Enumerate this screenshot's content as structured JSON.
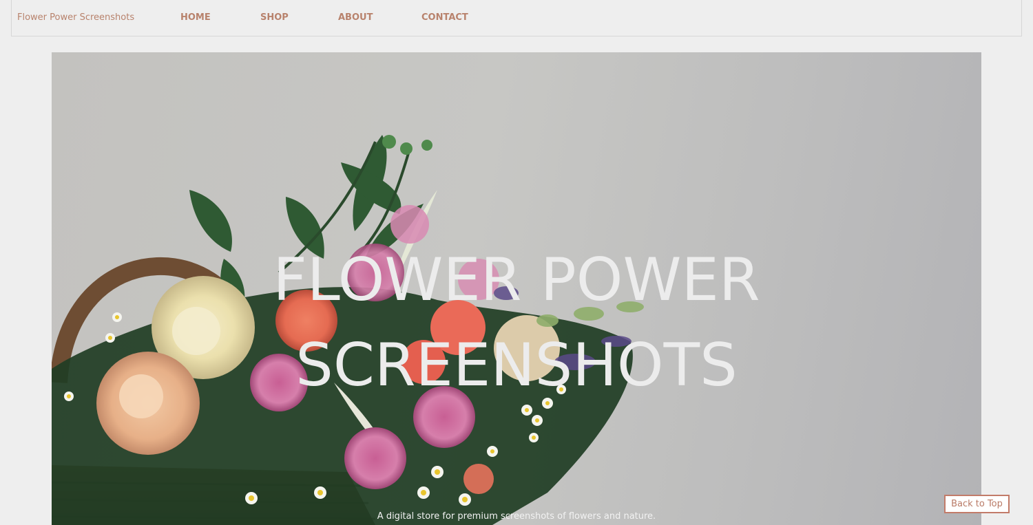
{
  "navbar": {
    "brand": "Flower Power Screenshots",
    "links": [
      {
        "label": "HOME"
      },
      {
        "label": "SHOP"
      },
      {
        "label": "ABOUT"
      },
      {
        "label": "CONTACT"
      }
    ]
  },
  "hero": {
    "title_line1": "FLOWER POWER",
    "title_line2": "SCREENSHOTS",
    "subtitle": "A digital store for premium screenshots of flowers and nature.",
    "image_description_icon": "flower-basket-photo"
  },
  "back_to_top": {
    "label": "Back to Top"
  },
  "colors": {
    "accent": "#b8826c",
    "button_border": "#c27b69",
    "background": "#eeeeee",
    "hero_text": "#ececec"
  }
}
